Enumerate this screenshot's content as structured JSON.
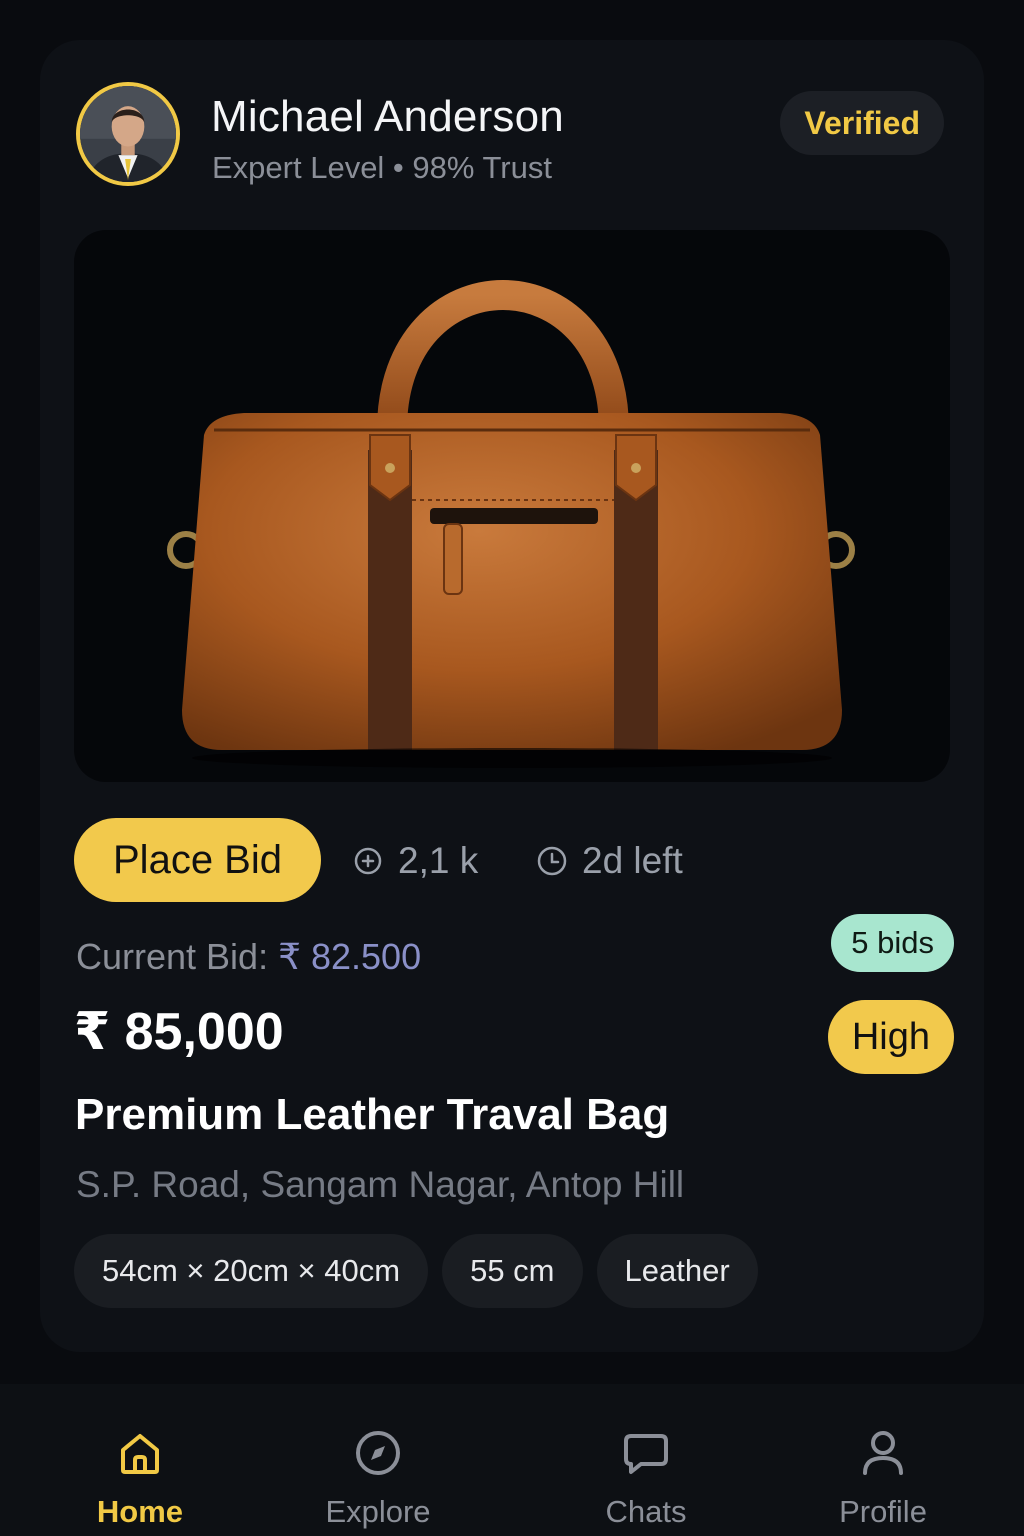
{
  "seller": {
    "name": "Michael Anderson",
    "meta": "Expert Level • 98% Trust",
    "badge": "Verified"
  },
  "product": {
    "image_icon": "leather-duffel-bag-photo",
    "title": "Premium Leather Traval Bag",
    "location": "S.P. Road, Sangam Nagar, Antop Hill",
    "price": "₹ 85,000",
    "specs": [
      "54cm × 20cm × 40cm",
      "55 cm",
      "Leather"
    ]
  },
  "actions": {
    "place_bid_label": "Place Bid",
    "views": "2,1 k",
    "time_left": "2d left"
  },
  "bid": {
    "current_label": "Current Bid: ",
    "current_amount": "₹ 82.500",
    "count_badge": "5 bids",
    "level_badge": "High"
  },
  "nav": {
    "items": [
      {
        "label": "Home",
        "icon": "home-icon",
        "active": true
      },
      {
        "label": "Explore",
        "icon": "compass-icon",
        "active": false
      },
      {
        "label": "Chats",
        "icon": "chat-bubble-icon",
        "active": false
      },
      {
        "label": "Profile",
        "icon": "person-icon",
        "active": false
      }
    ]
  },
  "colors": {
    "accent": "#f2c94c",
    "background": "#090b0f",
    "card": "#0e1116",
    "bids_badge": "#a8e6cf",
    "current_bid_amount": "#8a90c8"
  }
}
